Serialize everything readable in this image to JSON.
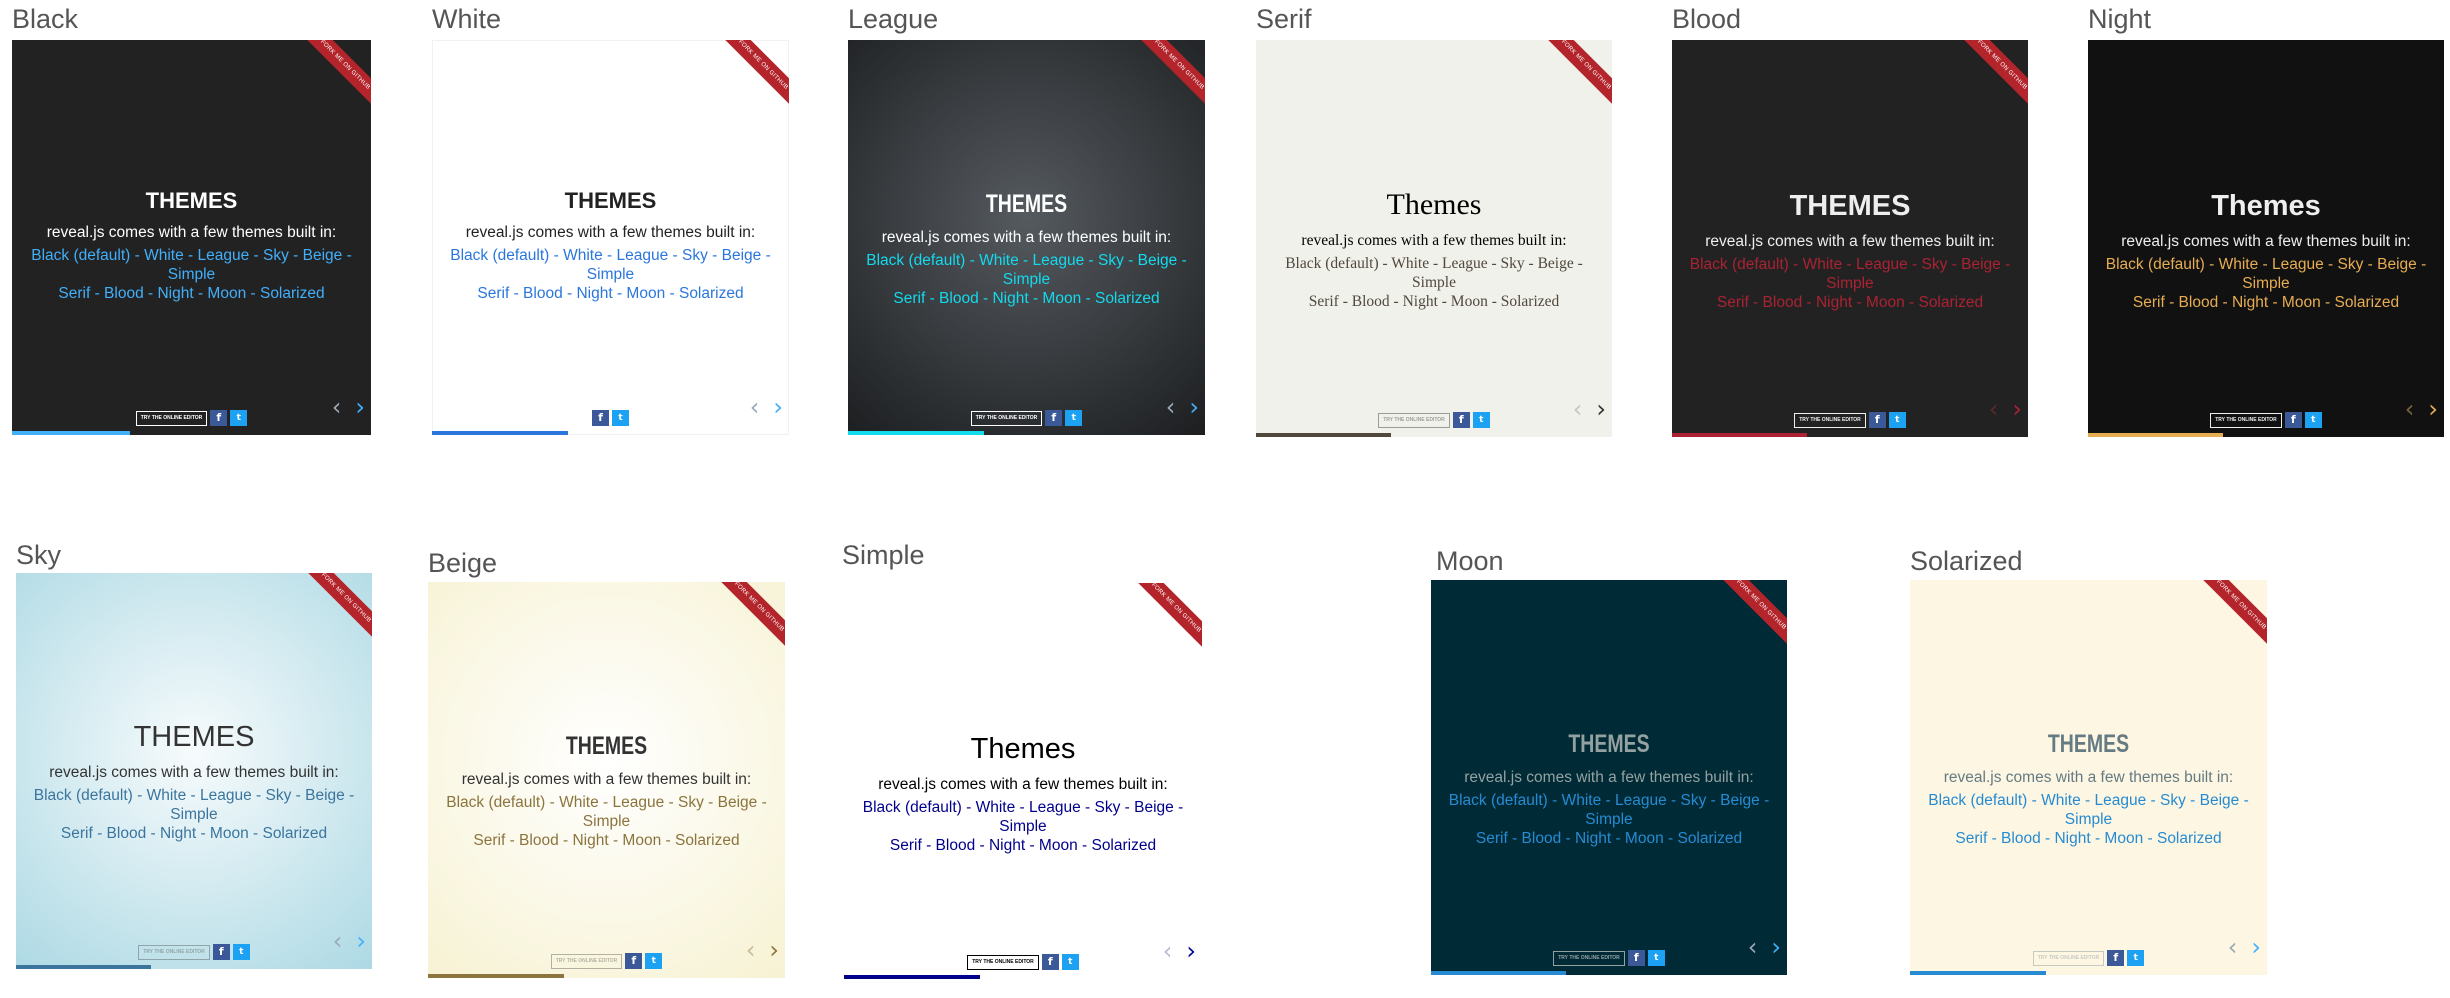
{
  "subtitle": "reveal.js comes with a few themes built in:",
  "link_line1": "Black (default) - White - League - Sky - Beige - Simple",
  "link_line2": "Serif - Blood - Night - Moon - Solarized",
  "link_line1_short": "Black (default) - White - League - Sky - Beige -",
  "link_line1_last": "Simple",
  "editor_button": "TRY THE ONLINE EDITOR",
  "ribbon_text": "FORK ME ON GITHUB",
  "icons": {
    "facebook": "facebook-icon",
    "twitter": "twitter-icon",
    "prev": "chevron-left-icon",
    "next": "chevron-right-icon"
  },
  "themes": [
    {
      "name": "Black",
      "title": "THEMES",
      "background": "#222222",
      "text": "#ffffff",
      "link": "#42affa",
      "progress": 0.33
    },
    {
      "name": "White",
      "title": "THEMES",
      "background": "#ffffff",
      "text": "#222222",
      "link": "#2a76dd",
      "progress": 0.38
    },
    {
      "name": "League",
      "title": "THEMES",
      "background": "#2b2b2b",
      "text": "#ffffff",
      "link": "#13daec",
      "progress": 0.38
    },
    {
      "name": "Serif",
      "title": "Themes",
      "background": "#f0f1eb",
      "text": "#000000",
      "link": "#51483d",
      "progress": 0.38
    },
    {
      "name": "Blood",
      "title": "THEMES",
      "background": "#222222",
      "text": "#eeeeee",
      "link": "#a23",
      "progress": 0.38
    },
    {
      "name": "Night",
      "title": "Themes",
      "background": "#111111",
      "text": "#eeeeee",
      "link": "#e7ad52",
      "progress": 0.38
    },
    {
      "name": "Sky",
      "title": "THEMES",
      "background": "#dcedf1",
      "text": "#333333",
      "link": "#3b759e",
      "progress": 0.38
    },
    {
      "name": "Beige",
      "title": "THEMES",
      "background": "#f7f3de",
      "text": "#333333",
      "link": "#8b743d",
      "progress": 0.38
    },
    {
      "name": "Simple",
      "title": "Themes",
      "background": "#ffffff",
      "text": "#000000",
      "link": "#00008b",
      "progress": 0.38
    },
    {
      "name": "Moon",
      "title": "THEMES",
      "background": "#002b36",
      "text": "#93a1a1",
      "link": "#268bd2",
      "progress": 0.38
    },
    {
      "name": "Solarized",
      "title": "THEMES",
      "background": "#fdf6e3",
      "text": "#657b83",
      "link": "#268bd2",
      "progress": 0.38
    }
  ]
}
